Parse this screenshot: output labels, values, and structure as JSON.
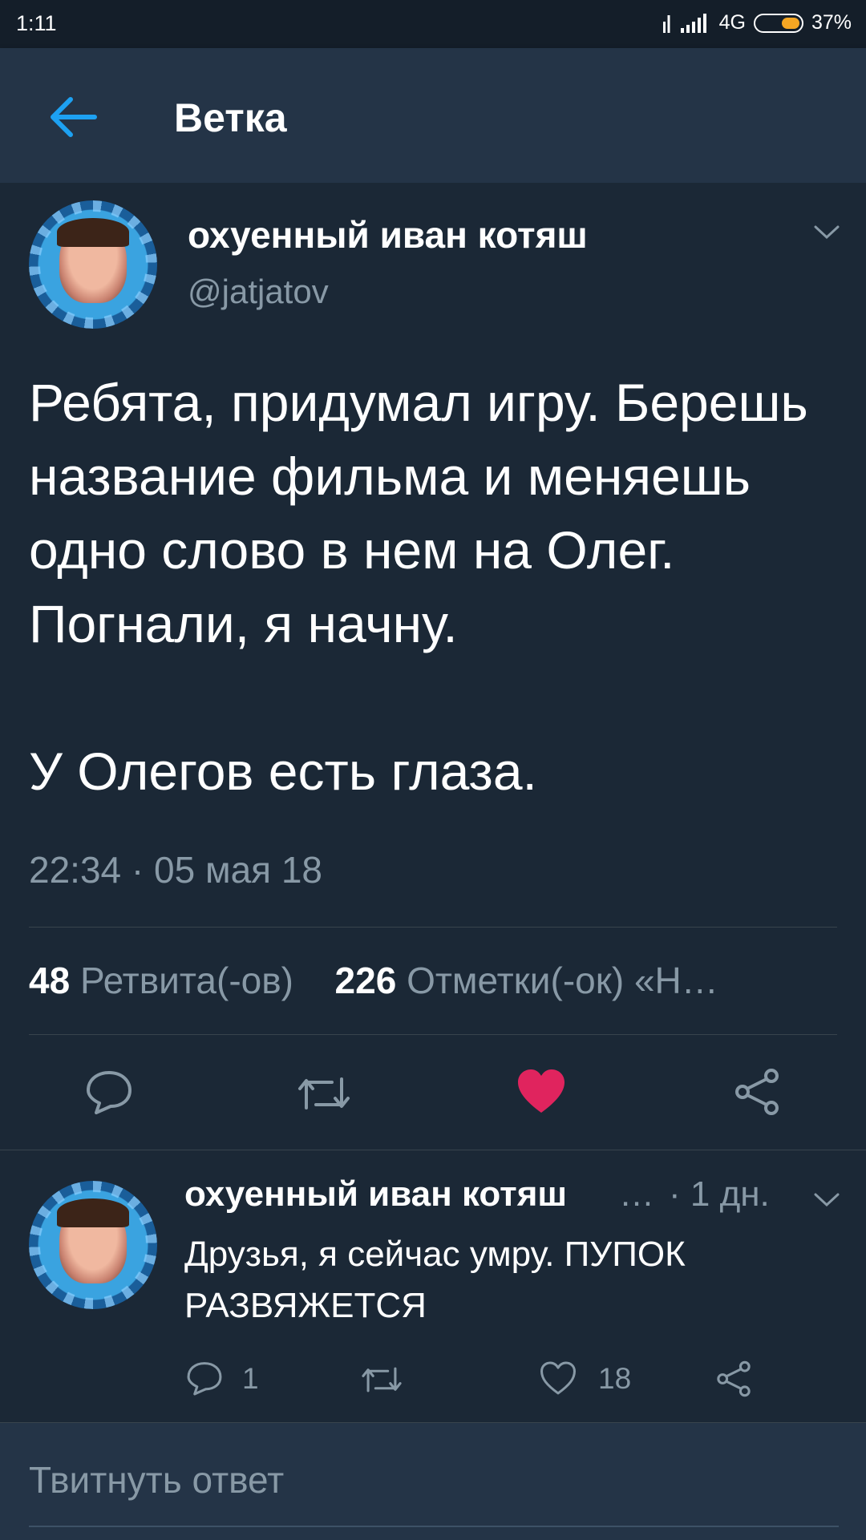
{
  "status_bar": {
    "time": "1:11",
    "network": "4G",
    "battery": "37%",
    "battery_level": 0.37,
    "accent": "#f5a623"
  },
  "header": {
    "title": "Ветка",
    "back_icon": "arrow-left-icon",
    "accent": "#1da1f2"
  },
  "main_tweet": {
    "author_name": "охуенный иван котяш",
    "handle": "@jatjatov",
    "text": "Ребята, придумал игру. Берешь название фильма и меняешь одно слово в нем на Олег. Погнали, я начну.\n\nУ Олегов есть глаза.",
    "timestamp": "22:34 · 05 мая 18",
    "retweets_count": "48",
    "retweets_label": "Ретвита(-ов)",
    "likes_count": "226",
    "likes_label": "Отметки(-ок) «Н…",
    "actions": [
      "reply-icon",
      "retweet-icon",
      "heart-icon",
      "share-icon"
    ],
    "liked": true,
    "like_color": "#e0245e"
  },
  "reply_tweet": {
    "author_name": "охуенный иван котяш",
    "ellipsis": "…",
    "age": "· 1 дн.",
    "text": "Друзья, я сейчас умру. ПУПОК РАЗВЯЖЕТСЯ",
    "reply_count": "1",
    "like_count": "18",
    "actions": [
      "reply-icon",
      "retweet-icon",
      "heart-icon",
      "share-icon"
    ]
  },
  "compose": {
    "placeholder": "Твитнуть ответ"
  }
}
